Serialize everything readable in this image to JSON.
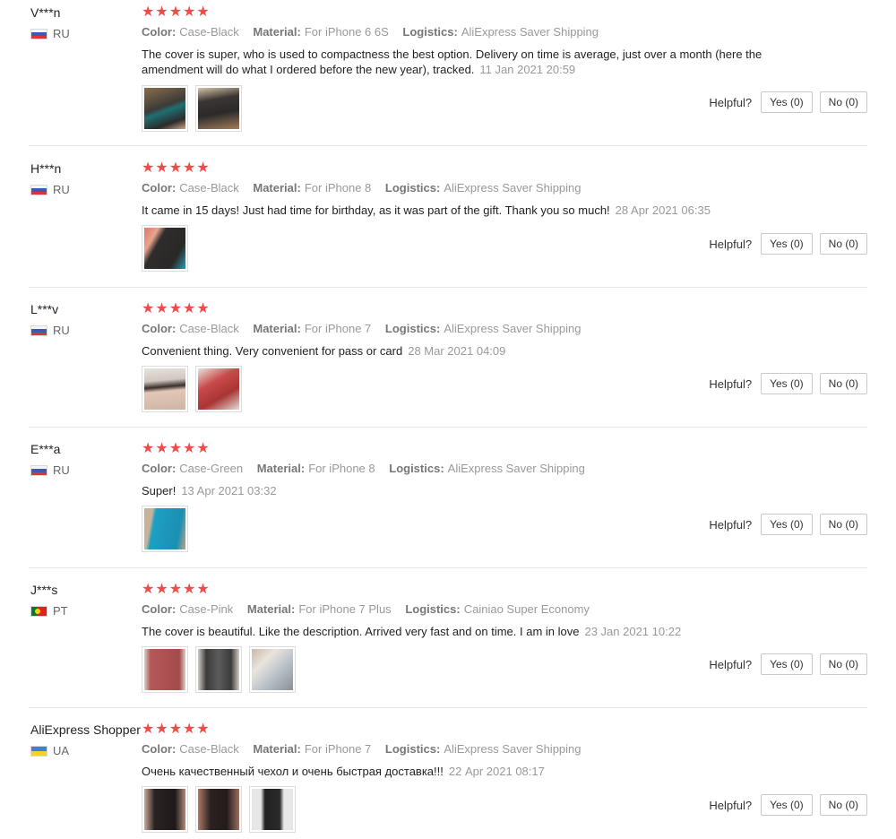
{
  "stars": "★★★★★",
  "reviews": [
    {
      "user": "V***n",
      "country": "RU",
      "color_label": "Color:",
      "color_value": "Case-Black",
      "material_label": "Material:",
      "material_value": "For iPhone 6 6S",
      "logistics_label": "Logistics:",
      "logistics_value": "AliExpress Saver Shipping",
      "text": "The cover is super, who is used to compactness the best option. Delivery on time is average, just over a month (here the amendment will do what I ordered before the new year), tracked.",
      "date": "11 Jan 2021 20:59",
      "helpful_label": "Helpful?",
      "yes_label": "Yes (0)",
      "no_label": "No (0)"
    },
    {
      "user": "H***n",
      "country": "RU",
      "color_label": "Color:",
      "color_value": "Case-Black",
      "material_label": "Material:",
      "material_value": "For iPhone 8",
      "logistics_label": "Logistics:",
      "logistics_value": "AliExpress Saver Shipping",
      "text": "It came in 15 days! Just had time for birthday, as it was part of the gift. Thank you so much!",
      "date": "28 Apr 2021 06:35",
      "helpful_label": "Helpful?",
      "yes_label": "Yes (0)",
      "no_label": "No (0)"
    },
    {
      "user": "L***v",
      "country": "RU",
      "color_label": "Color:",
      "color_value": "Case-Black",
      "material_label": "Material:",
      "material_value": "For iPhone 7",
      "logistics_label": "Logistics:",
      "logistics_value": "AliExpress Saver Shipping",
      "text": "Convenient thing. Very convenient for pass or card",
      "date": "28 Mar 2021 04:09",
      "helpful_label": "Helpful?",
      "yes_label": "Yes (0)",
      "no_label": "No (0)"
    },
    {
      "user": "E***a",
      "country": "RU",
      "color_label": "Color:",
      "color_value": "Case-Green",
      "material_label": "Material:",
      "material_value": "For iPhone 8",
      "logistics_label": "Logistics:",
      "logistics_value": "AliExpress Saver Shipping",
      "text": "Super!",
      "date": "13 Apr 2021 03:32",
      "helpful_label": "Helpful?",
      "yes_label": "Yes (0)",
      "no_label": "No (0)"
    },
    {
      "user": "J***s",
      "country": "PT",
      "color_label": "Color:",
      "color_value": "Case-Pink",
      "material_label": "Material:",
      "material_value": "For iPhone 7 Plus",
      "logistics_label": "Logistics:",
      "logistics_value": "Cainiao Super Economy",
      "text": "The cover is beautiful. Like the description. Arrived very fast and on time. I am in love",
      "date": "23 Jan 2021 10:22",
      "helpful_label": "Helpful?",
      "yes_label": "Yes (0)",
      "no_label": "No (0)"
    },
    {
      "user": "AliExpress Shopper",
      "country": "UA",
      "color_label": "Color:",
      "color_value": "Case-Black",
      "material_label": "Material:",
      "material_value": "For iPhone 7",
      "logistics_label": "Logistics:",
      "logistics_value": "AliExpress Saver Shipping",
      "text": "Очень качественный чехол и очень быстрая доставка!!!",
      "date": "22 Apr 2021 08:17",
      "helpful_label": "Helpful?",
      "yes_label": "Yes (0)",
      "no_label": "No (0)"
    }
  ],
  "colors": {
    "star": "#f04b4b",
    "muted_text": "#999999"
  }
}
